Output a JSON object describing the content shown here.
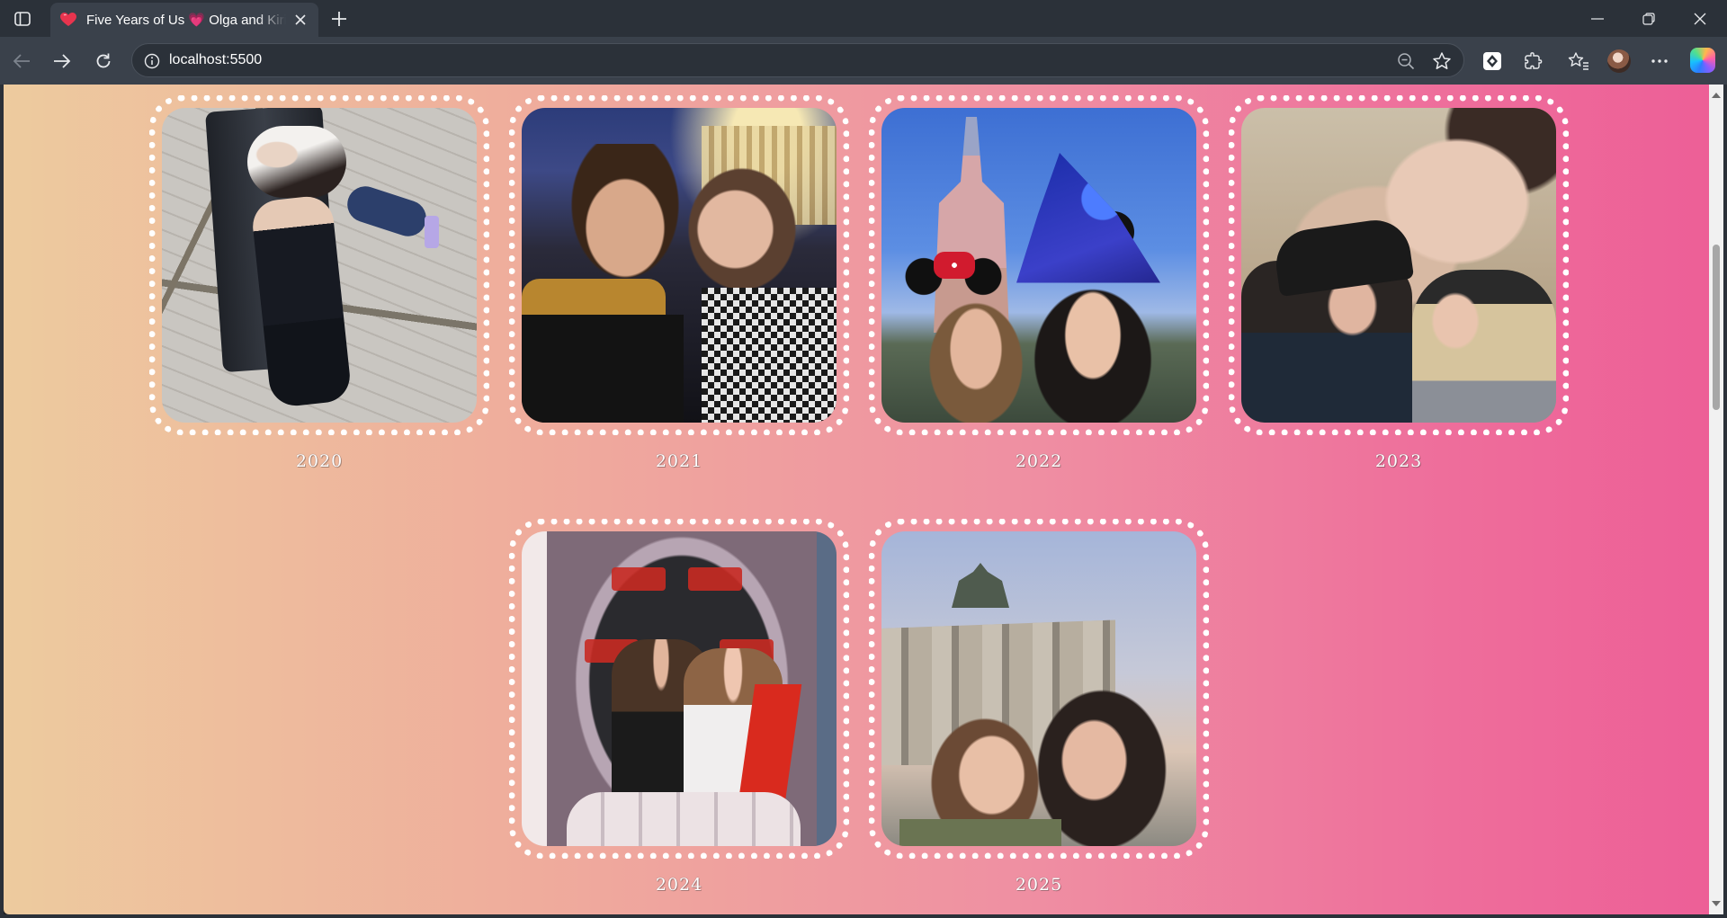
{
  "browser": {
    "tab": {
      "title": "Five Years of Us 💗 Olga and Kiril",
      "favicon": "heart-icon"
    },
    "address": {
      "url": "localhost:5500"
    },
    "colors": {
      "chrome_dark": "#2b3139",
      "chrome_toolbar": "#3a414b"
    }
  },
  "page": {
    "background": [
      "#edcb9e",
      "#ee6d9b"
    ],
    "frame_style": "white dotted rounded border",
    "gallery": [
      {
        "year": "2020",
        "photo": "couple lying on a black sofa, seen from above"
      },
      {
        "year": "2021",
        "photo": "night selfie in front of lit building"
      },
      {
        "year": "2022",
        "photo": "selfie with castle, mouse ears and wizard hat"
      },
      {
        "year": "2023",
        "photo": "kiss in front of wall mural"
      },
      {
        "year": "2024",
        "photo": "photo booth in vampire musical mouth"
      },
      {
        "year": "2025",
        "photo": "selfie in front of Brandenburg Gate"
      }
    ]
  }
}
